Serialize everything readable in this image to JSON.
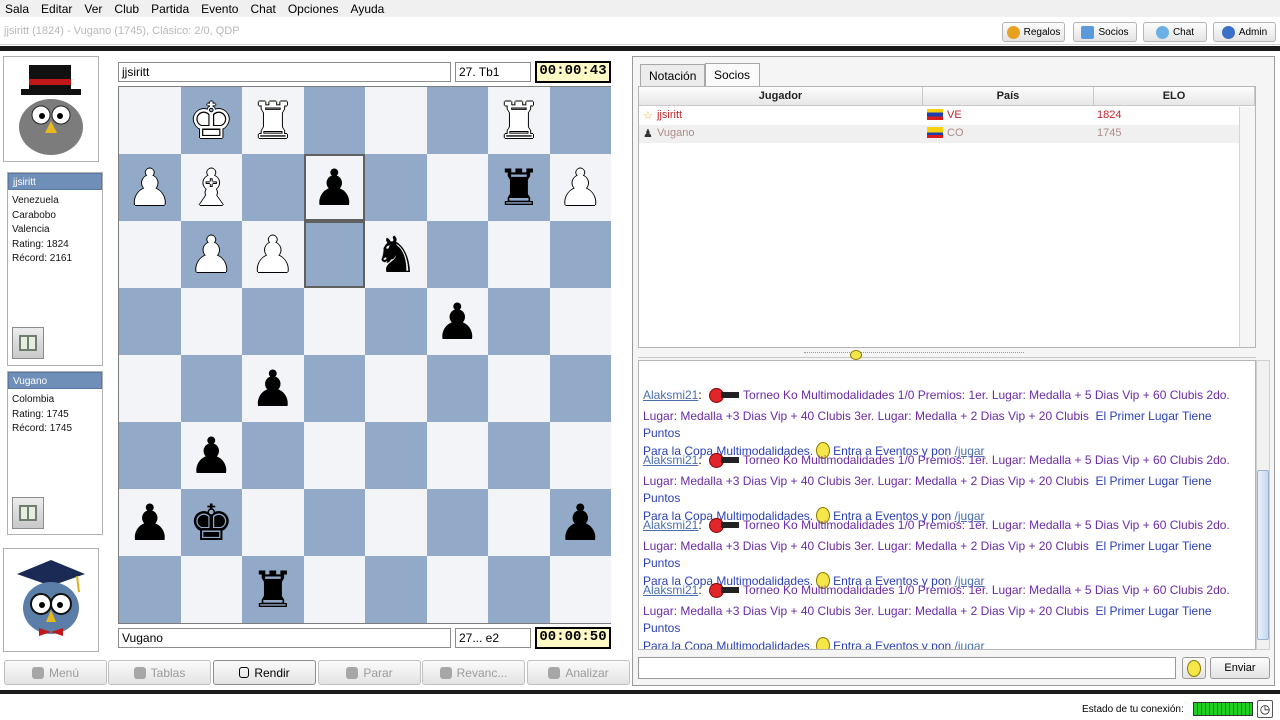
{
  "menu": [
    "Sala",
    "Editar",
    "Ver",
    "Club",
    "Partida",
    "Evento",
    "Chat",
    "Opciones",
    "Ayuda"
  ],
  "game_title": "jjsiritt (1824) - Vugano (1745), Clásico: 2/0, QDP",
  "top_buttons": [
    "Regalos",
    "Socios",
    "Chat",
    "Admin"
  ],
  "top_player": {
    "name": "jjsiritt",
    "last_move": "27. Tb1",
    "clock": "00:00:43"
  },
  "bottom_player": {
    "name": "Vugano",
    "last_move": "27... e2",
    "clock": "00:00:50"
  },
  "player1": {
    "name": "jjsiritt",
    "lines": [
      "Venezuela",
      "Carabobo",
      "Valencia",
      "Rating: 1824",
      "Récord: 2161"
    ]
  },
  "player2": {
    "name": "Vugano",
    "lines": [
      "Colombia",
      "Rating: 1745",
      "Récord: 1745"
    ]
  },
  "board": [
    [
      "",
      "wK",
      "wR",
      "",
      "",
      "",
      "wR",
      ""
    ],
    [
      "wP",
      "wB",
      "",
      "bP",
      "",
      "",
      "bR",
      "wP"
    ],
    [
      "",
      "wP",
      "wP",
      "",
      "bN",
      "",
      "",
      ""
    ],
    [
      "",
      "",
      "",
      "",
      "",
      "bP",
      "",
      ""
    ],
    [
      "",
      "",
      "bP",
      "",
      "",
      "",
      "",
      ""
    ],
    [
      "",
      "bP",
      "",
      "",
      "",
      "",
      "",
      ""
    ],
    [
      "bP",
      "bK",
      "",
      "",
      "",
      "",
      "",
      "bP"
    ],
    [
      "",
      "",
      "bR",
      "",
      "",
      "",
      "",
      ""
    ]
  ],
  "bottom_buttons": [
    {
      "label": "Menú",
      "active": false
    },
    {
      "label": "Tablas",
      "active": false
    },
    {
      "label": "Rendir",
      "active": true
    },
    {
      "label": "Parar",
      "active": false
    },
    {
      "label": "Revanc...",
      "active": false
    },
    {
      "label": "Analizar",
      "active": false
    }
  ],
  "tabs": [
    "Notación",
    "Socios"
  ],
  "players_table": {
    "headers": [
      "Jugador",
      "País",
      "ELO"
    ],
    "rows": [
      {
        "name": "jjsiritt",
        "country": "VE",
        "elo": "1824",
        "color": "#c0262b"
      },
      {
        "name": "Vugano",
        "country": "CO",
        "elo": "1745",
        "color": "#b08a8a"
      }
    ]
  },
  "chat": {
    "messages": [
      {
        "user": "Alaksmi21",
        "line1": "Torneo Ko  Multimodalidades 1/0  Premios: 1er. Lugar: Medalla + 5 Dias Vip + 60 Clubis   2do.",
        "line2a": "Lugar:  Medalla +3 Dias Vip + 40 Clubis  3er. Lugar: Medalla + 2 Dias Vip + 20 Clubis",
        "line2b": "El Primer Lugar Tiene Puntos",
        "line3a": "Para la Copa Multimodalidades.",
        "line3b": "Entra a Eventos y pon",
        "link": "/jugar"
      },
      {
        "user": "Alaksmi21",
        "line1": "Torneo Ko  Multimodalidades 1/0  Premios: 1er. Lugar: Medalla + 5 Dias Vip + 60 Clubis   2do.",
        "line2a": "Lugar:  Medalla +3 Dias Vip + 40 Clubis  3er. Lugar: Medalla + 2 Dias Vip + 20 Clubis",
        "line2b": "El Primer Lugar Tiene Puntos",
        "line3a": "Para la Copa Multimodalidades.",
        "line3b": "Entra a Eventos y pon",
        "link": "/jugar"
      },
      {
        "user": "Alaksmi21",
        "line1": "Torneo Ko  Multimodalidades 1/0  Premios: 1er. Lugar: Medalla + 5 Dias Vip + 60 Clubis   2do.",
        "line2a": "Lugar:  Medalla +3 Dias Vip + 40 Clubis  3er. Lugar: Medalla + 2 Dias Vip + 20 Clubis",
        "line2b": "El Primer Lugar Tiene Puntos",
        "line3a": "Para la Copa Multimodalidades.",
        "line3b": "Entra a Eventos y pon",
        "link": "/jugar"
      },
      {
        "user": "Alaksmi21",
        "line1": "Torneo Ko  Multimodalidades 1/0  Premios: 1er. Lugar: Medalla + 5 Dias Vip + 60 Clubis   2do.",
        "line2a": "Lugar:  Medalla +3 Dias Vip + 40 Clubis  3er. Lugar: Medalla + 2 Dias Vip + 20 Clubis",
        "line2b": "El Primer Lugar Tiene Puntos",
        "line3a": "Para la Copa Multimodalidades.",
        "line3b": "Entra a Eventos y pon",
        "link": "/jugar"
      }
    ],
    "send_label": "Enviar"
  },
  "status": {
    "label": "Estado de tu conexión:"
  },
  "colors": {
    "board_light": "#f2f4f8",
    "board_dark": "#92a9c8",
    "clock_bg": "#fff9c6",
    "name_bar": "#6f8fb8"
  }
}
